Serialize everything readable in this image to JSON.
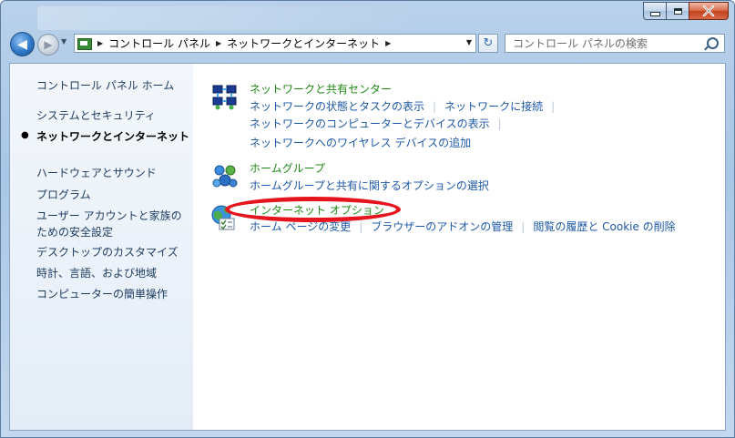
{
  "window": {
    "minimize_label": "–",
    "maximize_label": "□",
    "close_label": "✕"
  },
  "navigation": {
    "back_label": "◀",
    "forward_label": "▶",
    "breadcrumbs": [
      "コントロール パネル",
      "ネットワークとインターネット"
    ],
    "refresh_label": "↻"
  },
  "search": {
    "placeholder": "コントロール パネルの検索"
  },
  "sidebar": {
    "home": "コントロール パネル ホーム",
    "items": [
      "システムとセキュリティ",
      "ネットワークとインターネット",
      "ハードウェアとサウンド",
      "プログラム",
      "ユーザー アカウントと家族のための安全設定",
      "デスクトップのカスタマイズ",
      "時計、言語、および地域",
      "コンピューターの簡単操作"
    ],
    "active_index": 1
  },
  "categories": [
    {
      "title": "ネットワークと共有センター",
      "icon": "network-sharing-icon",
      "task_rows": [
        [
          "ネットワークの状態とタスクの表示",
          "ネットワークに接続"
        ],
        [
          "ネットワークのコンピューターとデバイスの表示"
        ],
        [
          "ネットワークへのワイヤレス デバイスの追加"
        ]
      ]
    },
    {
      "title": "ホームグループ",
      "icon": "homegroup-icon",
      "task_rows": [
        [
          "ホームグループと共有に関するオプションの選択"
        ]
      ]
    },
    {
      "title": "インターネット オプション",
      "icon": "internet-options-icon",
      "task_rows": [
        [
          "ホーム ページの変更",
          "ブラウザーのアドオンの管理",
          "閲覧の履歴と Cookie の削除"
        ]
      ]
    }
  ],
  "colors": {
    "category_title": "#1e8a13",
    "task_link": "#1d58a7",
    "highlight_annotation": "#e6141c"
  }
}
